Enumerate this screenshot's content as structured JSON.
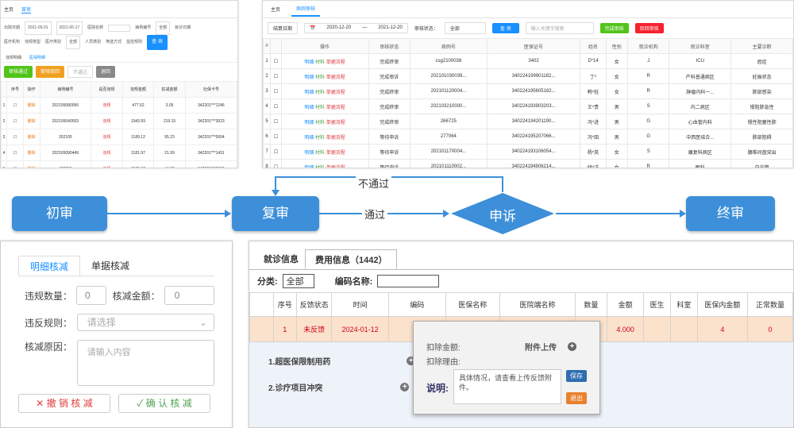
{
  "left_top": {
    "tabs": [
      "主页",
      "首审"
    ],
    "filters": [
      "出院日期",
      "2021-05-01",
      "2021-05-17",
      "医院名称",
      "病例编号",
      "全部",
      "就诊日期",
      "医疗机构",
      "违规类型",
      "医疗类别",
      "全部",
      "人员类别",
      "筛选方式",
      "监控规则"
    ],
    "tab_labels": [
      "违规明细",
      "医保明细"
    ],
    "buttons": [
      "审核通过",
      "审核驳回",
      "不通过",
      "退回"
    ],
    "query_btn": "查 询",
    "headers": [
      "",
      "序号",
      "操作",
      "病例编号",
      "是否违规",
      "违规项目",
      "违规金额",
      "扣减金额",
      "社保卡号",
      "备注"
    ],
    "rows": [
      [
        "1",
        "删除",
        "202105080056",
        "违规",
        "477.52",
        "3.05",
        "342201***1246"
      ],
      [
        "2",
        "删除",
        "202105040003",
        "违规",
        "1943.59",
        "219.15",
        "342201***3023"
      ],
      [
        "3",
        "删除",
        "202105",
        "违规",
        "1189.12",
        "95.23",
        "342201***0004"
      ],
      [
        "4",
        "删除",
        "202105090449",
        "违规",
        "1181.97",
        "21.59",
        "342201***1431"
      ],
      [
        "5",
        "删除",
        "479295",
        "违规",
        "1189.97",
        "44.09",
        "342201***0092"
      ]
    ]
  },
  "right_top": {
    "tabs": [
      "主页",
      "病例审核"
    ],
    "date_label": "结算日期",
    "date_from": "2020-12-20",
    "date_to": "2021-12-20",
    "status_label": "审核状态：",
    "status_value": "全部",
    "query": "查 询",
    "search_placeholder": "输入关键字搜索",
    "complete_btn": "完成审核",
    "reject_btn": "驳回审核",
    "headers": [
      "#",
      "",
      "操作",
      "审核状态",
      "病例号",
      "医保证号",
      "姓名",
      "性别",
      "就诊机构",
      "就诊科室",
      "主要诊断"
    ],
    "op_labels": [
      "明细",
      "材料",
      "单据流程"
    ],
    "rows": [
      [
        "1",
        "完成终审",
        "csg2100038",
        "3402",
        "D*14",
        "女",
        "J",
        "ICU",
        "癌症"
      ],
      [
        "2",
        "完成审诉",
        "202101030039...",
        "340224199901182...",
        "丁*",
        "女",
        "R",
        "产科普通病区",
        "妊娠状态"
      ],
      [
        "3",
        "完成终审",
        "202101120004...",
        "340224195605182...",
        "韩*桂",
        "女",
        "R",
        "肿瘤内科一...",
        "肺部感染"
      ],
      [
        "4",
        "完成终审",
        "202103210000...",
        "340224193903203...",
        "王*贵",
        "男",
        "S",
        "内二病区",
        "慢阻肺急性"
      ],
      [
        "5",
        "完成终审",
        "266725",
        "340224194201190...",
        "冯*进",
        "男",
        "G",
        "心血管内科",
        "慢性阻塞性肺"
      ],
      [
        "6",
        "等待申诉",
        "277064",
        "340224195207066...",
        "冯*田",
        "男",
        "G",
        "中西医结合...",
        "肺部阻碍"
      ],
      [
        "7",
        "等待申诉",
        "202101170004...",
        "340224193106054...",
        "杨*英",
        "女",
        "S",
        "康复科病区",
        "腰椎间盘突出"
      ],
      [
        "8",
        "等待申诉",
        "202101110002...",
        "340224194906214...",
        "姚*洋",
        "女",
        "R",
        "眼科",
        "白内障"
      ]
    ]
  },
  "flow": {
    "nodes": [
      "初审",
      "复审",
      "申诉",
      "终审"
    ],
    "pass_label": "通过",
    "fail_label": "不通过"
  },
  "left_bottom": {
    "tabs": [
      "明细核减",
      "单据核减"
    ],
    "violation_count_label": "违规数量：",
    "violation_count": "0",
    "deduct_amount_label": "核减金额：",
    "deduct_amount": "0",
    "rule_label": "违反规则：",
    "rule_placeholder": "请选择",
    "reason_label": "核减原因：",
    "reason_placeholder": "请输入内容",
    "cancel_btn": "撤 销 核 减",
    "confirm_btn": "确 认 核 减"
  },
  "right_bottom": {
    "tabs": [
      "就诊信息",
      "费用信息（1442）"
    ],
    "category_label": "分类:",
    "category_value": "全部",
    "code_name_label": "编码名称:",
    "headers": [
      "",
      "序号",
      "反馈状态",
      "时间",
      "编码",
      "医保名称",
      "医院端名称",
      "数量",
      "金额",
      "医生",
      "科室",
      "医保内金额",
      "正常数量"
    ],
    "row": [
      "",
      "1",
      "未反馈",
      "2024-01-12",
      "01",
      "",
      "",
      "",
      "4.000",
      "",
      "",
      "4",
      "0"
    ],
    "items": [
      "1.超医保限制用药",
      "2.诊疗项目冲突"
    ],
    "popup": {
      "deduct_amount": "扣除金额:",
      "deduct_reason": "扣除理由:",
      "attach": "附件上传",
      "explain_label": "说明:",
      "explain_text": "具体情况，请查看上传反馈附件。",
      "save": "保存",
      "exit": "退出"
    }
  }
}
